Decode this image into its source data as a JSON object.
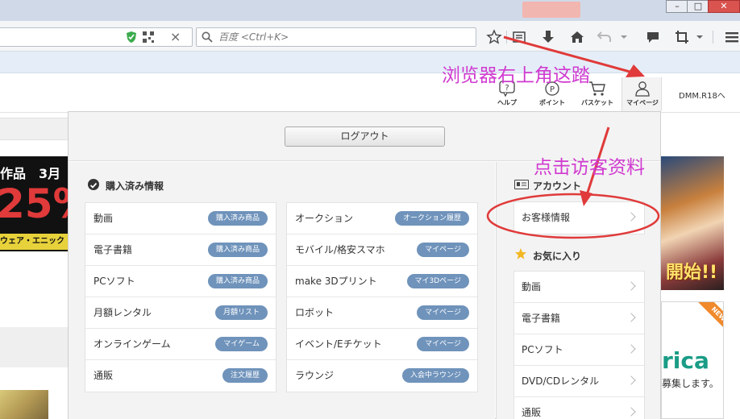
{
  "browser": {
    "search_placeholder": "百度 <Ctrl+K>",
    "window_buttons": [
      "–",
      "□",
      "✕"
    ]
  },
  "header": {
    "nav": [
      {
        "label": "ヘルプ",
        "icon": "help-icon"
      },
      {
        "label": "ポイント",
        "icon": "point-icon"
      },
      {
        "label": "バスケット",
        "icon": "basket-icon"
      },
      {
        "label": "マイページ",
        "icon": "user-icon"
      }
    ],
    "r18_label": "DMM.R18へ"
  },
  "left_banner": {
    "line1": "作品　3月",
    "big": "25%",
    "footer": "ウェア・エニック"
  },
  "right_banner": {
    "art_text": "開始!!",
    "new_badge": "NEW",
    "title_fragment": "rica",
    "sub_fragment": "募集します。"
  },
  "dropdown": {
    "logout_label": "ログアウト",
    "purchased_title": "購入済み情報",
    "left_rows": [
      {
        "label": "動画",
        "pill": "購入済み商品"
      },
      {
        "label": "電子書籍",
        "pill": "購入済み商品"
      },
      {
        "label": "PCソフト",
        "pill": "購入済み商品"
      },
      {
        "label": "月額レンタル",
        "pill": "月額リスト"
      },
      {
        "label": "オンラインゲーム",
        "pill": "マイゲーム"
      },
      {
        "label": "通販",
        "pill": "注文履歴"
      }
    ],
    "right_rows": [
      {
        "label": "オークション",
        "pill": "オークション履歴"
      },
      {
        "label": "モバイル/格安スマホ",
        "pill": "マイページ"
      },
      {
        "label": "make 3Dプリント",
        "pill": "マイ3Dページ"
      },
      {
        "label": "ロボット",
        "pill": "マイページ"
      },
      {
        "label": "イベント/Eチケット",
        "pill": "マイページ"
      },
      {
        "label": "ラウンジ",
        "pill": "入会中ラウンジ"
      }
    ],
    "account_title": "アカウント",
    "account_items": [
      "お客様情報"
    ],
    "favorites_title": "お気に入り",
    "favorites_items": [
      "動画",
      "電子書籍",
      "PCソフト",
      "DVD/CDレンタル",
      "通販"
    ]
  },
  "annotations": {
    "top_note": "浏览器右上角这踏",
    "click_note": "点击访客资料",
    "color": "#d03ad0"
  },
  "colors": {
    "pill": "#6f93bb",
    "panel_bg": "#f3f3f3"
  }
}
